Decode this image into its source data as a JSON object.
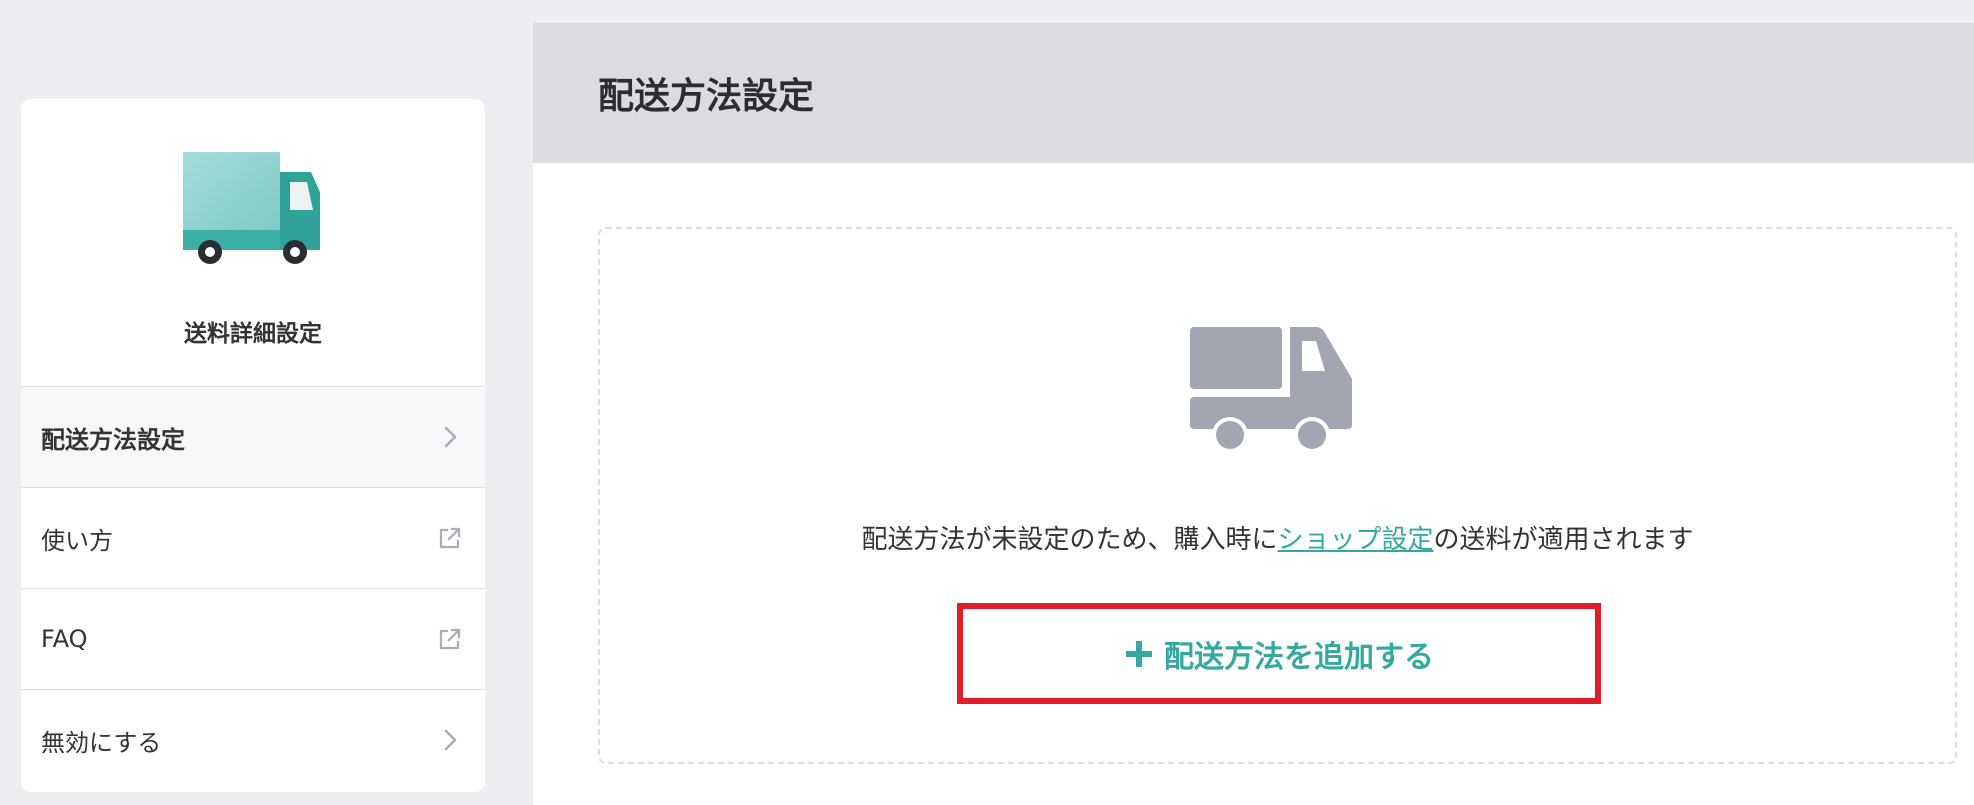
{
  "sidebar": {
    "title": "送料詳細設定",
    "items": [
      {
        "label": "配送方法設定",
        "icon": "chevron-right-icon",
        "active": true
      },
      {
        "label": "使い方",
        "icon": "external-link-icon"
      },
      {
        "label": "FAQ",
        "icon": "external-link-icon"
      },
      {
        "label": "無効にする",
        "icon": "chevron-right-icon"
      }
    ]
  },
  "main": {
    "title": "配送方法設定",
    "empty_message_before": "配送方法が未設定のため、購入時に",
    "empty_message_link": "ショップ設定",
    "empty_message_after": "の送料が適用されます",
    "add_button_label": "配送方法を追加する"
  },
  "colors": {
    "accent": "#33a9a0",
    "highlight_border": "#e21d2a",
    "header_bg": "#dbdce0",
    "page_bg": "#eceef2",
    "truck_gray": "#a2a6b0"
  }
}
